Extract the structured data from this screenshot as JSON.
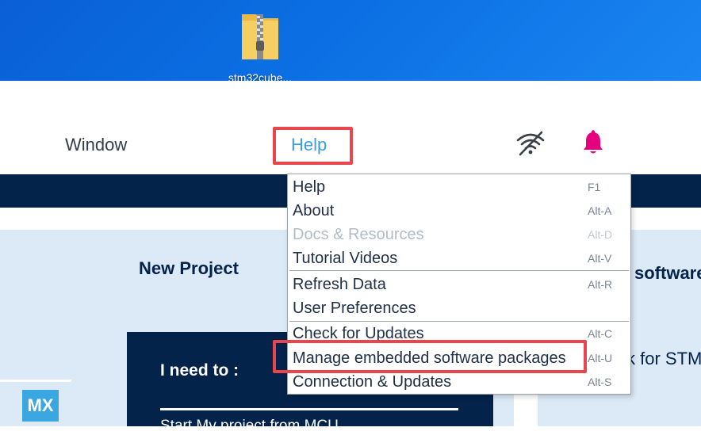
{
  "desktop": {
    "icon_label": "stm32cube..."
  },
  "menubar": {
    "window_label": "Window",
    "help_label": "Help"
  },
  "content": {
    "new_project_title": "New Project",
    "right_title": "software",
    "right_text": "k for STM",
    "need_to": "I need to :",
    "start_text": "Start My project from MCU",
    "mx_badge": "MX"
  },
  "help_menu": {
    "items": [
      {
        "label": "Help",
        "shortcut": "F1"
      },
      {
        "label": "About",
        "shortcut": "Alt-A"
      },
      {
        "label": "Docs & Resources",
        "shortcut": "Alt-D"
      },
      {
        "label": "Tutorial Videos",
        "shortcut": "Alt-V"
      },
      {
        "label": "Refresh Data",
        "shortcut": "Alt-R"
      },
      {
        "label": "User Preferences",
        "shortcut": ""
      },
      {
        "label": "Check for Updates",
        "shortcut": "Alt-C"
      },
      {
        "label": "Manage embedded software packages",
        "shortcut": "Alt-U"
      },
      {
        "label": "Connection & Updates",
        "shortcut": "Alt-S"
      }
    ]
  },
  "colors": {
    "accent_blue": "#3a9ee0",
    "navy": "#03234b",
    "highlight_red": "#e8464c",
    "bell_pink": "#e6007e"
  }
}
